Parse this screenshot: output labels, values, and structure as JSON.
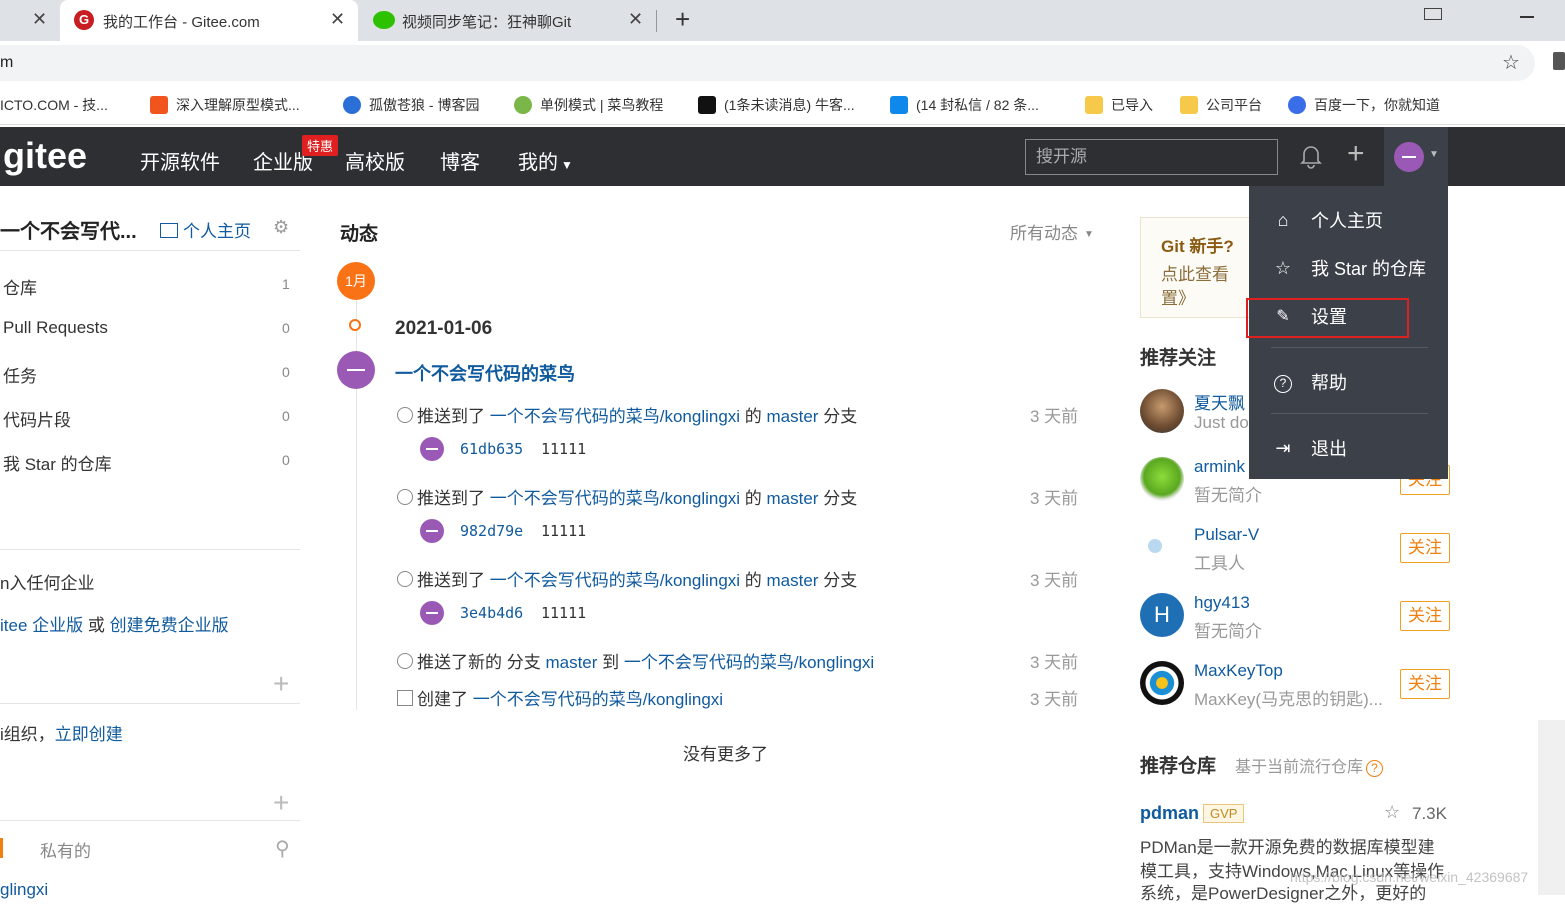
{
  "browser": {
    "tabs": [
      {
        "title": "我的工作台 - Gitee.com",
        "active": true
      },
      {
        "title": "视频同步笔记：狂神聊Git",
        "active": false
      }
    ],
    "address": "m",
    "bookmarks": [
      "ICTO.COM - 技...",
      "深入理解原型模式...",
      "孤傲苍狼 - 博客园",
      "单例模式 | 菜鸟教程",
      "(1条未读消息) 牛客...",
      "(14 封私信 / 82 条...",
      "已导入",
      "公司平台",
      "百度一下，你就知道"
    ]
  },
  "header": {
    "logo": "gitee",
    "nav": [
      "开源软件",
      "企业版",
      "高校版",
      "博客",
      "我的"
    ],
    "badge": "特惠",
    "search_placeholder": "搜开源"
  },
  "sidebar": {
    "username": "一个不会写代...",
    "homepage": "个人主页",
    "items": [
      {
        "label": "仓库",
        "count": "1"
      },
      {
        "label": "Pull Requests",
        "count": "0"
      },
      {
        "label": "任务",
        "count": "0"
      },
      {
        "label": "代码片段",
        "count": "0"
      },
      {
        "label": "我 Star 的仓库",
        "count": "0"
      }
    ],
    "enterprise_text": "n入任何企业",
    "enterprise_link1": "itee 企业版",
    "enterprise_or": " 或 ",
    "enterprise_link2": "创建免费企业版",
    "org_text": "i组织，",
    "org_link": "立即创建",
    "repo_tab": "私有的",
    "repo_item": "glingxi"
  },
  "feed": {
    "title": "动态",
    "filter": "所有动态",
    "month": "1月",
    "date": "2021-01-06",
    "user": "一个不会写代码的菜鸟",
    "events": [
      {
        "prefix": "推送到了 ",
        "repo": "一个不会写代码的菜鸟/konglingxi",
        "mid": " 的 ",
        "branch": "master",
        "suffix": " 分支",
        "ago": "3 天前",
        "sha": "61db635",
        "msg": "11111"
      },
      {
        "prefix": "推送到了 ",
        "repo": "一个不会写代码的菜鸟/konglingxi",
        "mid": " 的 ",
        "branch": "master",
        "suffix": " 分支",
        "ago": "3 天前",
        "sha": "982d79e",
        "msg": "11111"
      },
      {
        "prefix": "推送到了 ",
        "repo": "一个不会写代码的菜鸟/konglingxi",
        "mid": " 的 ",
        "branch": "master",
        "suffix": " 分支",
        "ago": "3 天前",
        "sha": "3e4b4d6",
        "msg": "11111"
      }
    ],
    "branch_event": {
      "prefix": "推送了新的 分支 ",
      "branch": "master",
      "mid": " 到 ",
      "repo": "一个不会写代码的菜鸟/konglingxi",
      "ago": "3 天前"
    },
    "create_event": {
      "prefix": "创建了 ",
      "repo": "一个不会写代码的菜鸟/konglingxi",
      "ago": "3 天前"
    },
    "no_more": "没有更多了"
  },
  "right": {
    "newbie_title": "Git 新手?",
    "newbie_text1": "点此查看",
    "newbie_text2": "置》",
    "rec_title": "推荐关注",
    "users": [
      {
        "name": "夏天飘",
        "bio": "Just do",
        "follow": "关注"
      },
      {
        "name": "armink",
        "bio": "暂无简介",
        "follow": "关注"
      },
      {
        "name": "Pulsar-V",
        "bio": "工具人",
        "follow": "关注"
      },
      {
        "name": "hgy413",
        "bio": "暂无简介",
        "follow": "关注"
      },
      {
        "name": "MaxKeyTop",
        "bio": "MaxKey(马克思的钥匙)...",
        "follow": "关注"
      }
    ],
    "repo_title": "推荐仓库",
    "repo_subtitle": "基于当前流行仓库",
    "repo_name": "pdman",
    "repo_badge": "GVP",
    "repo_stars": "7.3K",
    "repo_desc1": "PDMan是一款开源免费的数据库模型建",
    "repo_desc2": "模工具，支持Windows,Mac,Linux等操作",
    "repo_desc3": "系统，是PowerDesigner之外，更好的",
    "watermark": "https://blog.csdn.net/weixin_42369687"
  },
  "dropdown": {
    "items": [
      "个人主页",
      "我 Star 的仓库",
      "设置",
      "帮助",
      "退出"
    ],
    "highlight_color": "#e02020"
  }
}
